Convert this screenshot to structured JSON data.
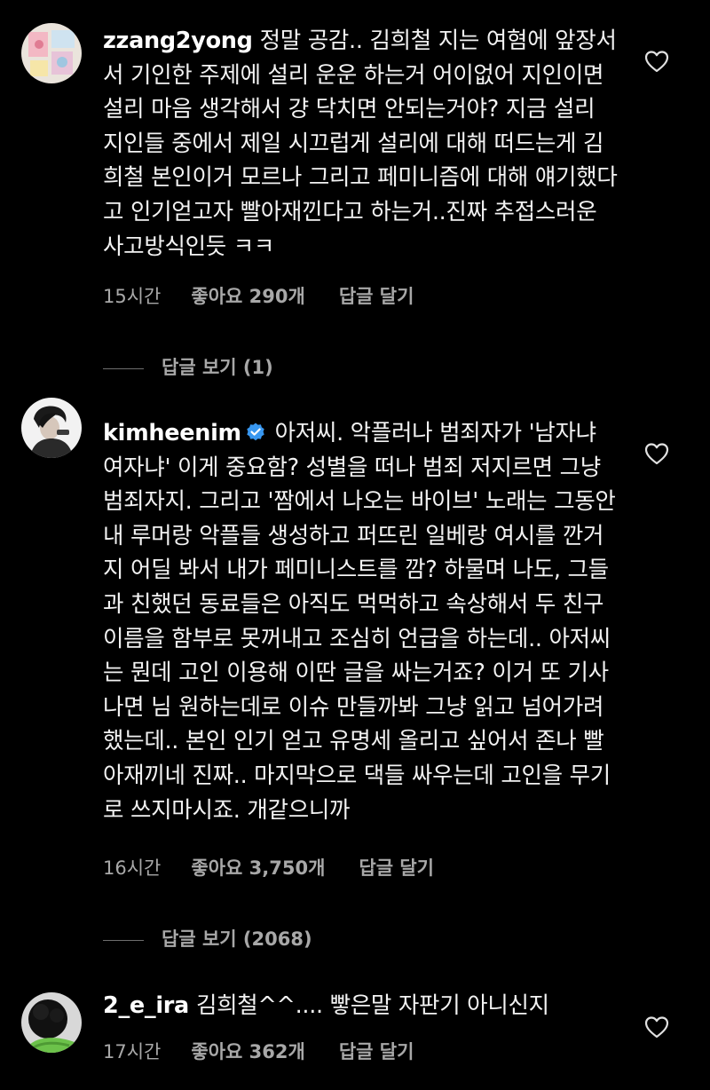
{
  "comments": [
    {
      "username": "zzang2yong",
      "verified": false,
      "text": "정말 공감.. 김희철 지는 여혐에 앞장서서 기인한 주제에 설리 운운 하는거 어이없어 지인이면 설리 마음 생각해서 걍 닥치면 안되는거야? 지금 설리 지인들 중에서 제일 시끄럽게 설리에 대해 떠드는게 김희철 본인이거 모르나 그리고 페미니즘에 대해 얘기했다고 인기얻고자 빨아재낀다고 하는거..진짜 추접스러운 사고방식인듯 ㅋㅋ",
      "time": "15시간",
      "likes": "좋아요 290개",
      "reply_label": "답글 달기",
      "view_replies": "답글 보기 (1)"
    },
    {
      "username": "kimheenim",
      "verified": true,
      "text": "아저씨. 악플러나 범죄자가 '남자냐 여자냐' 이게 중요함? 성별을 떠나 범죄 저지르면 그냥 범죄자지. 그리고 '짬에서 나오는 바이브' 노래는 그동안 내 루머랑 악플들 생성하고 퍼뜨린 일베랑 여시를 깐거지 어딜 봐서 내가 페미니스트를 깜? 하물며 나도, 그들과 친했던 동료들은 아직도 먹먹하고 속상해서 두 친구 이름을 함부로 못꺼내고 조심히 언급을 하는데.. 아저씨는 뭔데 고인 이용해 이딴 글을 싸는거죠? 이거 또 기사나면 님 원하는데로 이슈 만들까봐 그냥 읽고 넘어가려했는데.. 본인 인기 얻고 유명세 올리고 싶어서 존나 빨아재끼네 진짜.. 마지막으로 댁들 싸우는데 고인을 무기로 쓰지마시죠. 개같으니까",
      "time": "16시간",
      "likes": "좋아요 3,750개",
      "reply_label": "답글 달기",
      "view_replies": "답글 보기 (2068)"
    },
    {
      "username": "2_e_ira",
      "verified": false,
      "text": "김희철^^.... 빻은말 자판기 아니신지",
      "time": "17시간",
      "likes": "좋아요 362개",
      "reply_label": "답글 달기"
    }
  ],
  "icons": {
    "like": "heart-icon",
    "verified": "verified-badge-icon"
  },
  "colors": {
    "background": "#000000",
    "text": "#f2f2f2",
    "meta": "#a8a8a8",
    "verified": "#3897f0"
  }
}
